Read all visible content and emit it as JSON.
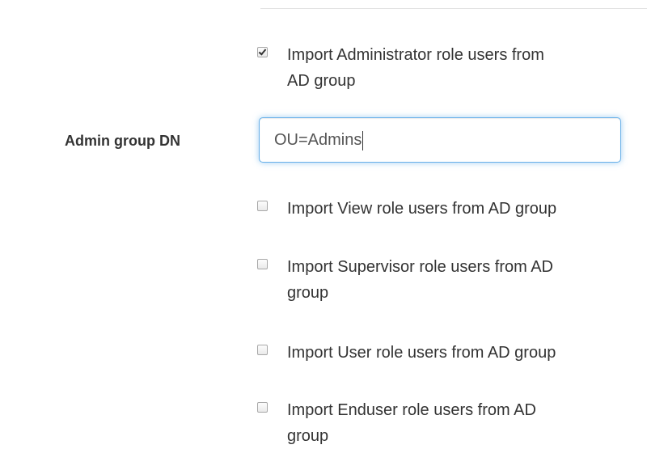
{
  "form": {
    "import_admin": {
      "label_line1": "Import Administrator role users from",
      "label_line2": "AD group",
      "checked": true
    },
    "admin_group_dn": {
      "label": "Admin group DN",
      "value": "OU=Admins"
    },
    "import_view": {
      "label": "Import View role users from AD group",
      "checked": false
    },
    "import_supervisor": {
      "label_line1": "Import Supervisor role users from AD",
      "label_line2": "group",
      "checked": false
    },
    "import_user": {
      "label": "Import User role users from AD group",
      "checked": false
    },
    "import_enduser": {
      "label_line1": "Import Enduser role users from AD",
      "label_line2": "group",
      "checked": false
    }
  },
  "colors": {
    "focus_border": "#66afe9",
    "text": "#333333"
  }
}
